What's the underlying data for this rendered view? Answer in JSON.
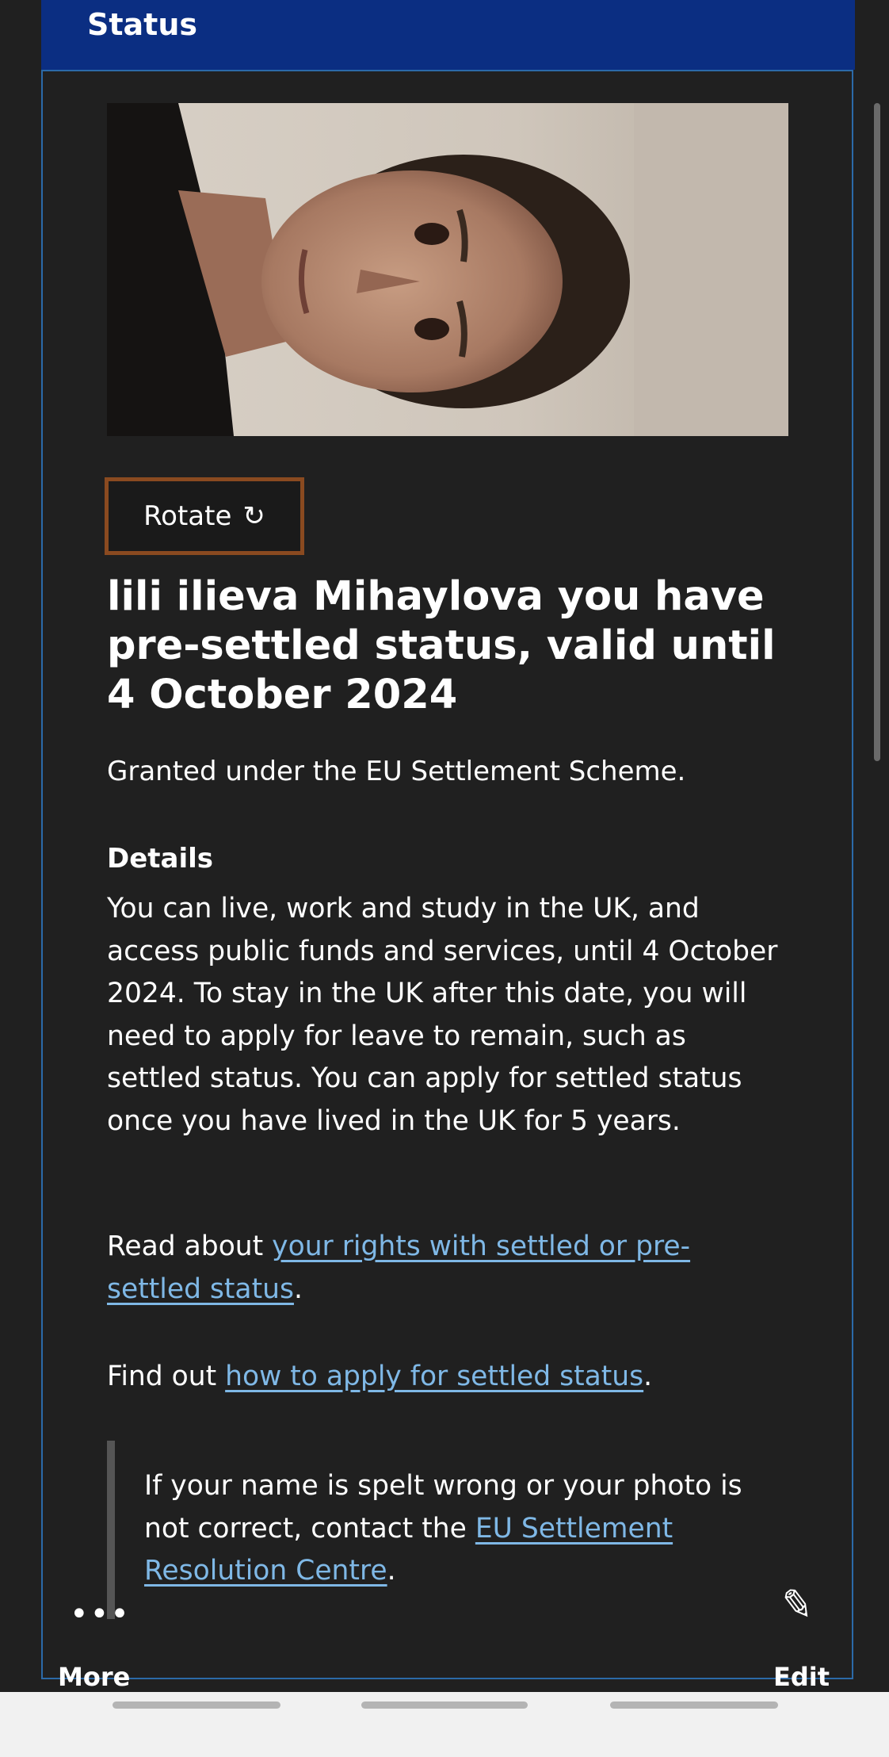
{
  "header": {
    "title": "Status"
  },
  "card": {
    "rotate_label": "Rotate",
    "rotate_icon": "↻",
    "title": "lili ilieva Mihaylova you have pre-settled status, valid until 4 October 2024",
    "granted": "Granted under the EU Settlement Scheme.",
    "details_heading": "Details",
    "details_body": "You can live, work and study in the UK, and access public funds and services, until 4 October 2024. To stay in the UK after this date, you will need to apply for leave to remain, such as settled status. You can apply for settled status once you have lived in the UK for 5 years.",
    "read_about_prefix": "Read about ",
    "read_about_link": "your rights with settled or pre-settled status",
    "read_about_suffix": ".",
    "find_out_prefix": "Find out ",
    "find_out_link": "how to apply for settled status",
    "find_out_suffix": ".",
    "callout_prefix": "If your name is spelt wrong or your photo is not correct, contact the ",
    "callout_link": "EU Settlement Resolution Centre",
    "callout_suffix": "."
  },
  "toolbar": {
    "more_label": "More",
    "more_icon": "•••",
    "edit_label": "Edit",
    "edit_icon": "✎"
  },
  "colors": {
    "header_bg": "#0b2e82",
    "card_border": "#2b6aa8",
    "link": "#7fb8e6",
    "rotate_border": "#8a4a20"
  }
}
